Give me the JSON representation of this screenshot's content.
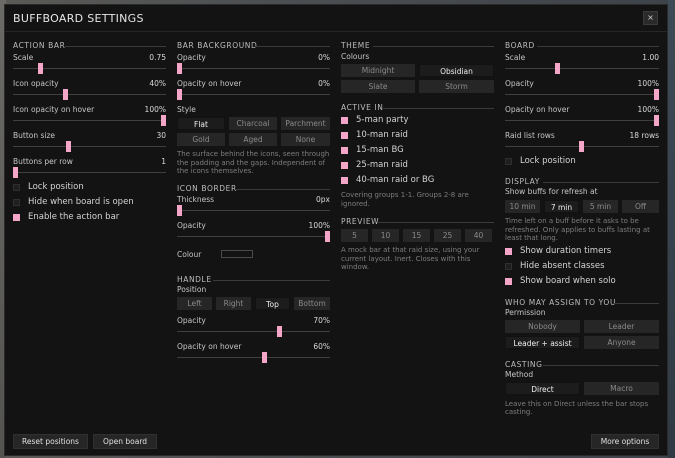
{
  "window": {
    "title": "BUFFBOARD SETTINGS",
    "close_label": "×"
  },
  "action_bar": {
    "header": "ACTION BAR",
    "scale_label": "Scale",
    "scale_value": "0.75",
    "icon_opacity_label": "Icon opacity",
    "icon_opacity_value": "40%",
    "hover_label": "Icon opacity on hover",
    "hover_value": "100%",
    "button_size_label": "Button size",
    "button_size_value": "30",
    "per_row_label": "Buttons per row",
    "per_row_value": "1",
    "lock_label": "Lock position",
    "hide_label": "Hide when board is open",
    "enable_label": "Enable the action bar"
  },
  "bar_background": {
    "header": "BAR BACKGROUND",
    "opacity_label": "Opacity",
    "opacity_value": "0%",
    "hover_label": "Opacity on hover",
    "hover_value": "0%",
    "style_label": "Style",
    "styles": [
      "Flat",
      "Charcoal",
      "Parchment",
      "Gold",
      "Aged",
      "None"
    ],
    "note": "The surface behind the icons, seen through the padding and the gaps. Independent of the icons themselves."
  },
  "icon_border": {
    "header": "ICON BORDER",
    "thickness_label": "Thickness",
    "thickness_value": "0px",
    "opacity_label": "Opacity",
    "opacity_value": "100%",
    "colour_label": "Colour"
  },
  "handle": {
    "header": "HANDLE",
    "position_label": "Position",
    "positions": [
      "Left",
      "Right",
      "Top",
      "Bottom"
    ],
    "opacity_label": "Opacity",
    "opacity_value": "70%",
    "hover_label": "Opacity on hover",
    "hover_value": "60%"
  },
  "theme": {
    "header": "THEME",
    "colours_label": "Colours",
    "options": [
      "Midnight",
      "Obsidian",
      "Slate",
      "Storm"
    ]
  },
  "active_in": {
    "header": "ACTIVE IN",
    "items": [
      "5-man party",
      "10-man raid",
      "15-man BG",
      "25-man raid",
      "40-man raid or BG"
    ],
    "note": "Covering groups 1-1. Groups 2-8 are ignored."
  },
  "preview": {
    "header": "PREVIEW",
    "options": [
      "5",
      "10",
      "15",
      "25",
      "40"
    ],
    "note": "A mock bar at that raid size, using your current layout. Inert. Closes with this window."
  },
  "board": {
    "header": "BOARD",
    "scale_label": "Scale",
    "scale_value": "1.00",
    "opacity_label": "Opacity",
    "opacity_value": "100%",
    "hover_label": "Opacity on hover",
    "hover_value": "100%",
    "rows_label": "Raid list rows",
    "rows_value": "18 rows",
    "lock_label": "Lock position"
  },
  "display": {
    "header": "DISPLAY",
    "refresh_label": "Show buffs for refresh at",
    "refresh_options": [
      "10 min",
      "7 min",
      "5 min",
      "Off"
    ],
    "note": "Time left on a buff before it asks to be refreshed. Only applies to buffs lasting at least that long.",
    "timers_label": "Show duration timers",
    "absent_label": "Hide absent classes",
    "solo_label": "Show board when solo"
  },
  "assign": {
    "header": "WHO MAY ASSIGN TO YOU",
    "permission_label": "Permission",
    "options": [
      "Nobody",
      "Leader",
      "Leader + assist",
      "Anyone"
    ]
  },
  "casting": {
    "header": "CASTING",
    "method_label": "Method",
    "options": [
      "Direct",
      "Macro"
    ],
    "note": "Leave this on Direct unless the bar stops casting."
  },
  "footer": {
    "reset_label": "Reset positions",
    "open_board_label": "Open board",
    "more_label": "More options"
  },
  "colors": {
    "accent": "#f4a6c8",
    "panel": "#131313",
    "button": "#262626"
  }
}
